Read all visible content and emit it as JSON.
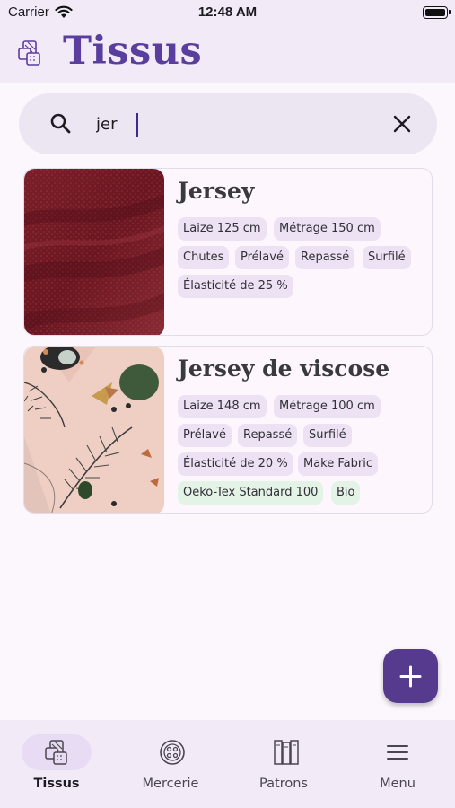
{
  "status_bar": {
    "carrier": "Carrier",
    "time": "12:48 AM"
  },
  "header": {
    "title": "Tissus",
    "icon": "fabric-swatch-icon"
  },
  "search": {
    "value": "jer",
    "placeholder": ""
  },
  "results": [
    {
      "title": "Jersey",
      "image": "burgundy-jersey-fabric",
      "chips": [
        {
          "label": "Laize 125 cm",
          "color": "#ece2f4"
        },
        {
          "label": "Métrage 150 cm",
          "color": "#ece2f4"
        },
        {
          "label": "Chutes",
          "color": "#ece2f4"
        },
        {
          "label": "Prélavé",
          "color": "#ece2f4"
        },
        {
          "label": "Repassé",
          "color": "#ece2f4"
        },
        {
          "label": "Surfilé",
          "color": "#ece2f4"
        },
        {
          "label": "Élasticité de 25 %",
          "color": "#ece2f4"
        }
      ]
    },
    {
      "title": "Jersey de viscose",
      "image": "floral-leaf-print-fabric",
      "chips": [
        {
          "label": "Laize 148 cm",
          "color": "#ece2f4"
        },
        {
          "label": "Métrage 100 cm",
          "color": "#ece2f4"
        },
        {
          "label": "Prélavé",
          "color": "#ece2f4"
        },
        {
          "label": "Repassé",
          "color": "#ece2f4"
        },
        {
          "label": "Surfilé",
          "color": "#ece2f4"
        },
        {
          "label": "Élasticité de 20 %",
          "color": "#ece2f4"
        },
        {
          "label": "Make Fabric",
          "color": "#ece2f4"
        },
        {
          "label": "Oeko-Tex Standard 100",
          "color": "#e3f3e6"
        },
        {
          "label": "Bio",
          "color": "#e3f3e6"
        }
      ]
    }
  ],
  "fab": {
    "icon": "plus-icon"
  },
  "bottom_nav": [
    {
      "label": "Tissus",
      "icon": "fabric-icon",
      "active": true
    },
    {
      "label": "Mercerie",
      "icon": "button-icon",
      "active": false
    },
    {
      "label": "Patrons",
      "icon": "pattern-icon",
      "active": false
    },
    {
      "label": "Menu",
      "icon": "menu-icon",
      "active": false
    }
  ],
  "colors": {
    "accent": "#553a8e",
    "title": "#5a3e9e",
    "chip": "#ece2f4",
    "chip_green": "#e3f3e6",
    "bar": "#f3eaf8"
  }
}
